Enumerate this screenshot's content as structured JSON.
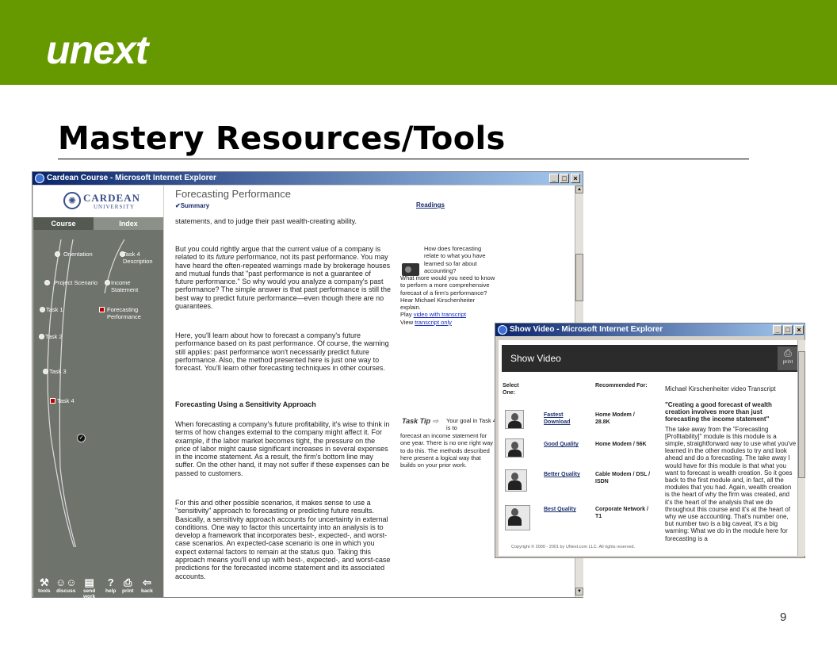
{
  "slide": {
    "logo": "unext",
    "title": "Mastery Resources/Tools",
    "page_number": "9"
  },
  "colors": {
    "banner": "#669900",
    "titlebar": "#0a246a",
    "sidebar": "#6e736c"
  },
  "main_window": {
    "title": "Cardean Course - Microsoft Internet Explorer",
    "sidebar": {
      "logo_name": "CARDEAN",
      "logo_sub": "UNIVERSITY",
      "tabs": {
        "course": "Course",
        "index": "Index"
      },
      "nodes": {
        "orientation": "Orientation",
        "task4_description": "Task 4\nDescription",
        "project_scenario": "Project Scenario",
        "income_statement": "Income\nStatement",
        "task1": "Task 1",
        "forecasting_performance": "Forecasting\nPerformance",
        "task2": "Task 2",
        "task3": "Task 3",
        "task4": "Task 4"
      },
      "tools": {
        "tools": "tools",
        "discuss": "discuss",
        "send_work": "send\nwork",
        "help": "help",
        "print": "print",
        "back": "back"
      }
    },
    "content": {
      "title": "Forecasting Performance",
      "summary": "Summary",
      "readings": "Readings",
      "p1": "statements, and to judge their past wealth-creating ability.",
      "p2_a": "But you could rightly argue that the current value of a company is related to its ",
      "p2_em": "future",
      "p2_b": " performance, not its past performance. You may have heard the often-repeated warnings made by brokerage houses and mutual funds that \"past performance is not a guarantee of future performance.\" So why would you analyze a company's past performance? The simple answer is that past performance is still the best way to predict future performance—even though there are no guarantees.",
      "p3": "Here, you'll learn about how to forecast a company's future performance based on its past performance. Of course, the warning still applies: past performance won't necessarily predict future performance. Also, the method presented here is just one way to forecast. You'll learn other forecasting techniques in other courses.",
      "heading": "Forecasting Using a Sensitivity Approach",
      "p4": "When forecasting a company's future profitability, it's wise to think in terms of how changes external to the company might affect it. For example, if the labor market becomes tight, the pressure on the price of labor might cause significant increases in several expenses in the income statement. As a result, the firm's bottom line may suffer. On the other hand, it may not suffer if these expenses can be passed to customers.",
      "p5": "For this and other possible scenarios, it makes sense to use a \"sensitivity\" approach to forecasting or predicting future results. Basically, a sensitivity approach accounts for uncertainty in external conditions. One way to factor this uncertainty into an analysis is to develop a framework that incorporates best-, expected-, and worst-case scenarios. An expected-case scenario is one in which you expect external factors to remain at the status quo. Taking this approach means you'll end up with best-, expected-, and worst-case predictions for the forecasted income statement and its associated accounts.",
      "side1_a": "How does forecasting relate to what you have learned so far about accounting?",
      "side1_b": "What more would you need to know to perform a more comprehensive forecast of a firm's performance? Hear Michael Kirschenheiter explain.",
      "play": "Play ",
      "video_link": "video with transcript",
      "view": "View ",
      "transcript_link": "transcript only",
      "tasktip": "Task Tip",
      "tasktip_text_a": "Your goal in Task 4 is to",
      "tasktip_text_b": "forecast an income statement for one year. There is no one right way to do this. The methods described here present a logical way that builds on your prior work."
    }
  },
  "video_window": {
    "title": "Show Video - Microsoft Internet Explorer",
    "header": "Show Video",
    "print": "print",
    "select_one": "Select\nOne:",
    "recommended_for": "Recommended For:",
    "options": [
      {
        "label": "Fastest\nDownload",
        "rec": "Home Modem /\n28.8K"
      },
      {
        "label": "Good Quality",
        "rec": "Home Modem / 56K"
      },
      {
        "label": "Better Quality",
        "rec": "Cable Modem / DSL /\nISDN"
      },
      {
        "label": "Best Quality",
        "rec": "Corporate Network /\nT1"
      }
    ],
    "transcript_head": "Michael Kirschenheiter video   Transcript",
    "quote": "\"Creating a good forecast of wealth creation involves more than just forecasting the income statement\"",
    "transcript": "The take away from the \"Forecasting [Profitability]\" module is this module is a simple, straightforward way to use what you've learned in the other modules to try and look ahead and do a forecasting. The take away I would have for this module is that what you want to forecast is wealth creation. So it goes back to the first module and, in fact, all the modules that you had. Again, wealth creation is the heart of why the firm was created, and it's the heart of the analysis that we do throughout this course and it's at the heart of why we use accounting. That's number one, but number two is a big caveat, it's a big warning: What we do in the module here for forecasting is a",
    "copyright": "Copyright © 2000 - 2001 by UNext.com LLC. All rights reserved."
  }
}
